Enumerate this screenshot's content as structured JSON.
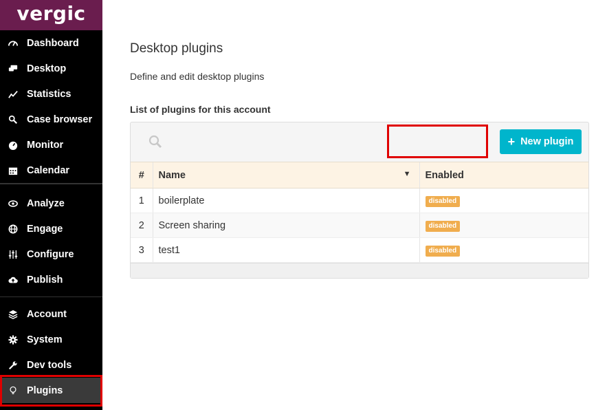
{
  "brand": {
    "logo_text": "vergic"
  },
  "sidebar": {
    "groups": [
      {
        "items": [
          {
            "label": "Dashboard",
            "icon": "gauge-icon"
          },
          {
            "label": "Desktop",
            "icon": "chat-icon"
          },
          {
            "label": "Statistics",
            "icon": "line-chart-icon"
          },
          {
            "label": "Case browser",
            "icon": "search-icon"
          },
          {
            "label": "Monitor",
            "icon": "dashboard-icon"
          },
          {
            "label": "Calendar",
            "icon": "calendar-icon"
          }
        ]
      },
      {
        "items": [
          {
            "label": "Analyze",
            "icon": "eye-icon"
          },
          {
            "label": "Engage",
            "icon": "globe-icon"
          },
          {
            "label": "Configure",
            "icon": "sliders-icon"
          },
          {
            "label": "Publish",
            "icon": "cloud-upload-icon"
          }
        ]
      },
      {
        "items": [
          {
            "label": "Account",
            "icon": "layers-icon"
          },
          {
            "label": "System",
            "icon": "gear-icon"
          },
          {
            "label": "Dev tools",
            "icon": "wrench-icon"
          },
          {
            "label": "Plugins",
            "icon": "lightbulb-icon",
            "active": true
          }
        ]
      }
    ]
  },
  "main": {
    "title": "Desktop plugins",
    "description": "Define and edit desktop plugins",
    "list_heading": "List of plugins for this account",
    "new_button": {
      "plus": "+",
      "label": "New plugin"
    },
    "table": {
      "headers": {
        "num": "#",
        "name": "Name",
        "enabled": "Enabled"
      },
      "rows": [
        {
          "num": "1",
          "name": "boilerplate",
          "status": "disabled"
        },
        {
          "num": "2",
          "name": "Screen sharing",
          "status": "disabled"
        },
        {
          "num": "3",
          "name": "test1",
          "status": "disabled"
        }
      ]
    }
  },
  "colors": {
    "brand": "#6a1d4e",
    "accent": "#00b5cc",
    "badge_disabled": "#f0ad4e",
    "highlight": "#e00000"
  }
}
